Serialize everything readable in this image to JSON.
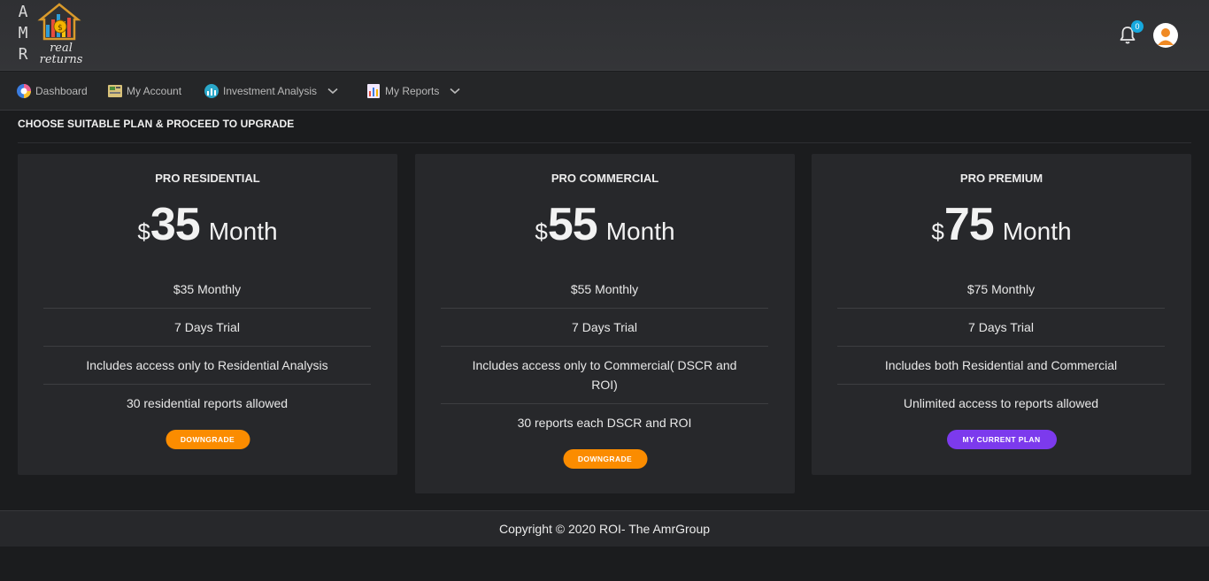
{
  "brand": {
    "letters": [
      "A",
      "M",
      "R"
    ],
    "name_line1": "real",
    "name_line2": "returns",
    "house_icon": "house-chart-logo-icon"
  },
  "header": {
    "notification_icon": "bell-icon",
    "notification_count": "0",
    "avatar_icon": "user-avatar-icon",
    "badge_color": "#16a8dd"
  },
  "nav": {
    "items": [
      {
        "label": "Dashboard",
        "icon": "dashboard-icon"
      },
      {
        "label": "My Account",
        "icon": "account-icon"
      },
      {
        "label": "Investment Analysis",
        "icon": "analysis-icon",
        "has_dropdown": true
      },
      {
        "label": "My Reports",
        "icon": "reports-icon",
        "has_dropdown": true
      }
    ]
  },
  "main": {
    "title": "CHOOSE SUITABLE PLAN & PROCEED TO UPGRADE",
    "plans": [
      {
        "title": "PRO RESIDENTIAL",
        "currency": "$",
        "price": "35",
        "period": "Month",
        "features": [
          "$35 Monthly",
          "7 Days Trial",
          "Includes access only to Residential Analysis",
          "30 residential reports allowed"
        ],
        "button": "DOWNGRADE",
        "button_color": "#fb8c00"
      },
      {
        "title": "PRO COMMERCIAL",
        "currency": "$",
        "price": "55",
        "period": "Month",
        "features": [
          "$55 Monthly",
          "7 Days Trial",
          "Includes access only to Commercial( DSCR and ROI)",
          "30 reports each DSCR and ROI"
        ],
        "button": "DOWNGRADE",
        "button_color": "#fb8c00"
      },
      {
        "title": "PRO PREMIUM",
        "currency": "$",
        "price": "75",
        "period": "Month",
        "features": [
          "$75 Monthly",
          "7 Days Trial",
          "Includes both Residential and Commercial",
          "Unlimited access to reports allowed"
        ],
        "button": "MY CURRENT PLAN",
        "button_color": "#7c3aed"
      }
    ]
  },
  "footer": {
    "text": "Copyright © 2020 ROI- The AmrGroup"
  }
}
